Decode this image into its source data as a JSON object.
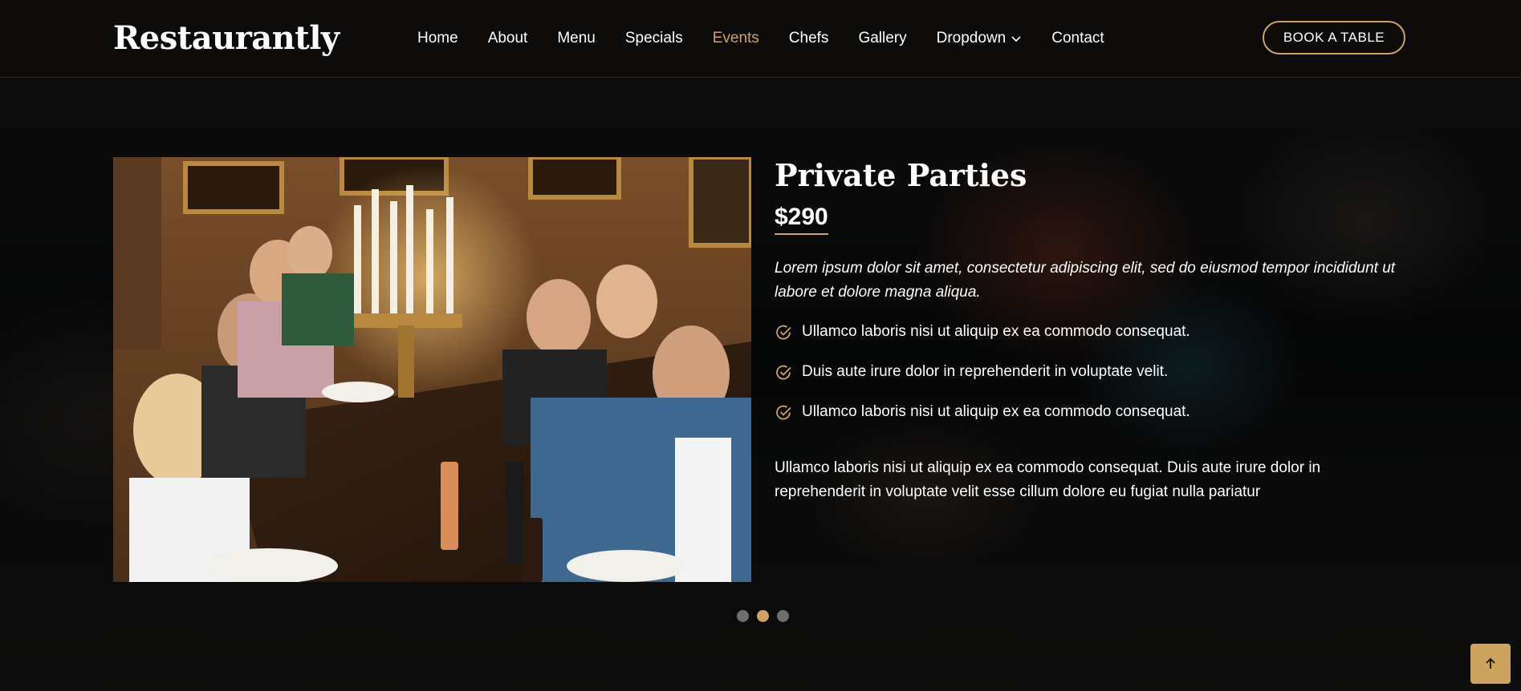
{
  "brand": {
    "name": "Restaurantly",
    "accent_color": "#cda45e"
  },
  "nav": {
    "items": [
      {
        "label": "Home",
        "active": false
      },
      {
        "label": "About",
        "active": false
      },
      {
        "label": "Menu",
        "active": false
      },
      {
        "label": "Specials",
        "active": false
      },
      {
        "label": "Events",
        "active": true
      },
      {
        "label": "Chefs",
        "active": false
      },
      {
        "label": "Gallery",
        "active": false
      },
      {
        "label": "Dropdown",
        "active": false,
        "icon": "chevron-down-icon"
      },
      {
        "label": "Contact",
        "active": false
      }
    ],
    "cta_label": "BOOK A TABLE"
  },
  "event": {
    "image_alt": "group-dinner-toast-photo",
    "title": "Private Parties",
    "price": "$290",
    "lead": "Lorem ipsum dolor sit amet, consectetur adipiscing elit, sed do eiusmod tempor incididunt ut labore et dolore magna aliqua.",
    "features": [
      "Ullamco laboris nisi ut aliquip ex ea commodo consequat.",
      "Duis aute irure dolor in reprehenderit in voluptate velit.",
      "Ullamco laboris nisi ut aliquip ex ea commodo consequat."
    ],
    "feature_icon": "check-circle-icon",
    "paragraph": "Ullamco laboris nisi ut aliquip ex ea commodo consequat. Duis aute irure dolor in reprehenderit in voluptate velit esse cillum dolore eu fugiat nulla pariatur"
  },
  "slider": {
    "slide_count": 3,
    "active_index": 1
  },
  "back_to_top": {
    "icon": "arrow-up-icon"
  }
}
